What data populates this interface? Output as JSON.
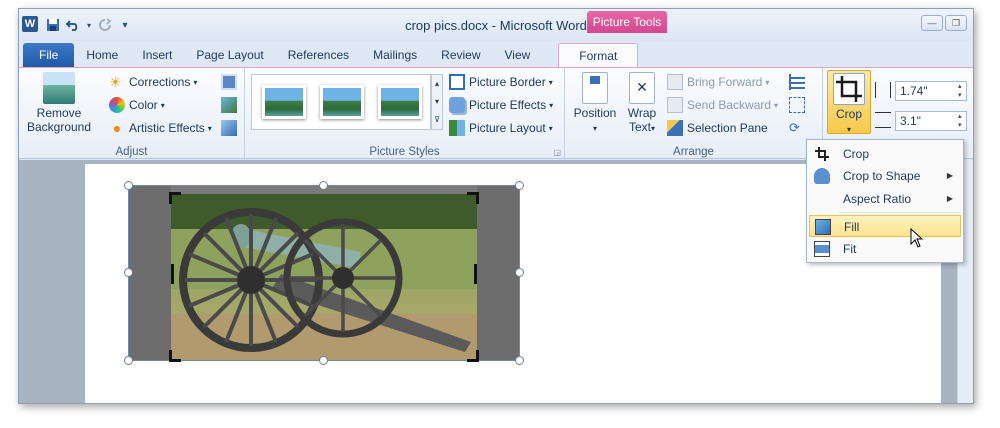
{
  "window": {
    "title": "crop pics.docx - Microsoft Word",
    "app_icon": "W"
  },
  "context_tab_header": "Picture Tools",
  "tabs": [
    "File",
    "Home",
    "Insert",
    "Page Layout",
    "References",
    "Mailings",
    "Review",
    "View",
    "Format"
  ],
  "active_tab": "Format",
  "ribbon": {
    "adjust": {
      "label": "Adjust",
      "remove_background": "Remove Background",
      "corrections": "Corrections",
      "color": "Color",
      "artistic_effects": "Artistic Effects"
    },
    "picture_styles": {
      "label": "Picture Styles",
      "picture_border": "Picture Border",
      "picture_effects": "Picture Effects",
      "picture_layout": "Picture Layout"
    },
    "arrange": {
      "label": "Arrange",
      "position": "Position",
      "wrap_text_1": "Wrap",
      "wrap_text_2": "Text",
      "bring_forward": "Bring Forward",
      "send_backward": "Send Backward",
      "selection_pane": "Selection Pane"
    },
    "size": {
      "crop": "Crop",
      "height": "1.74\"",
      "width": "3.1\""
    }
  },
  "crop_menu": {
    "crop": "Crop",
    "crop_to_shape": "Crop to Shape",
    "aspect_ratio": "Aspect Ratio",
    "fill": "Fill",
    "fit": "Fit"
  },
  "colors": {
    "accent": "#2b5797",
    "context": "#d6468f",
    "highlight": "#fbe38f"
  }
}
